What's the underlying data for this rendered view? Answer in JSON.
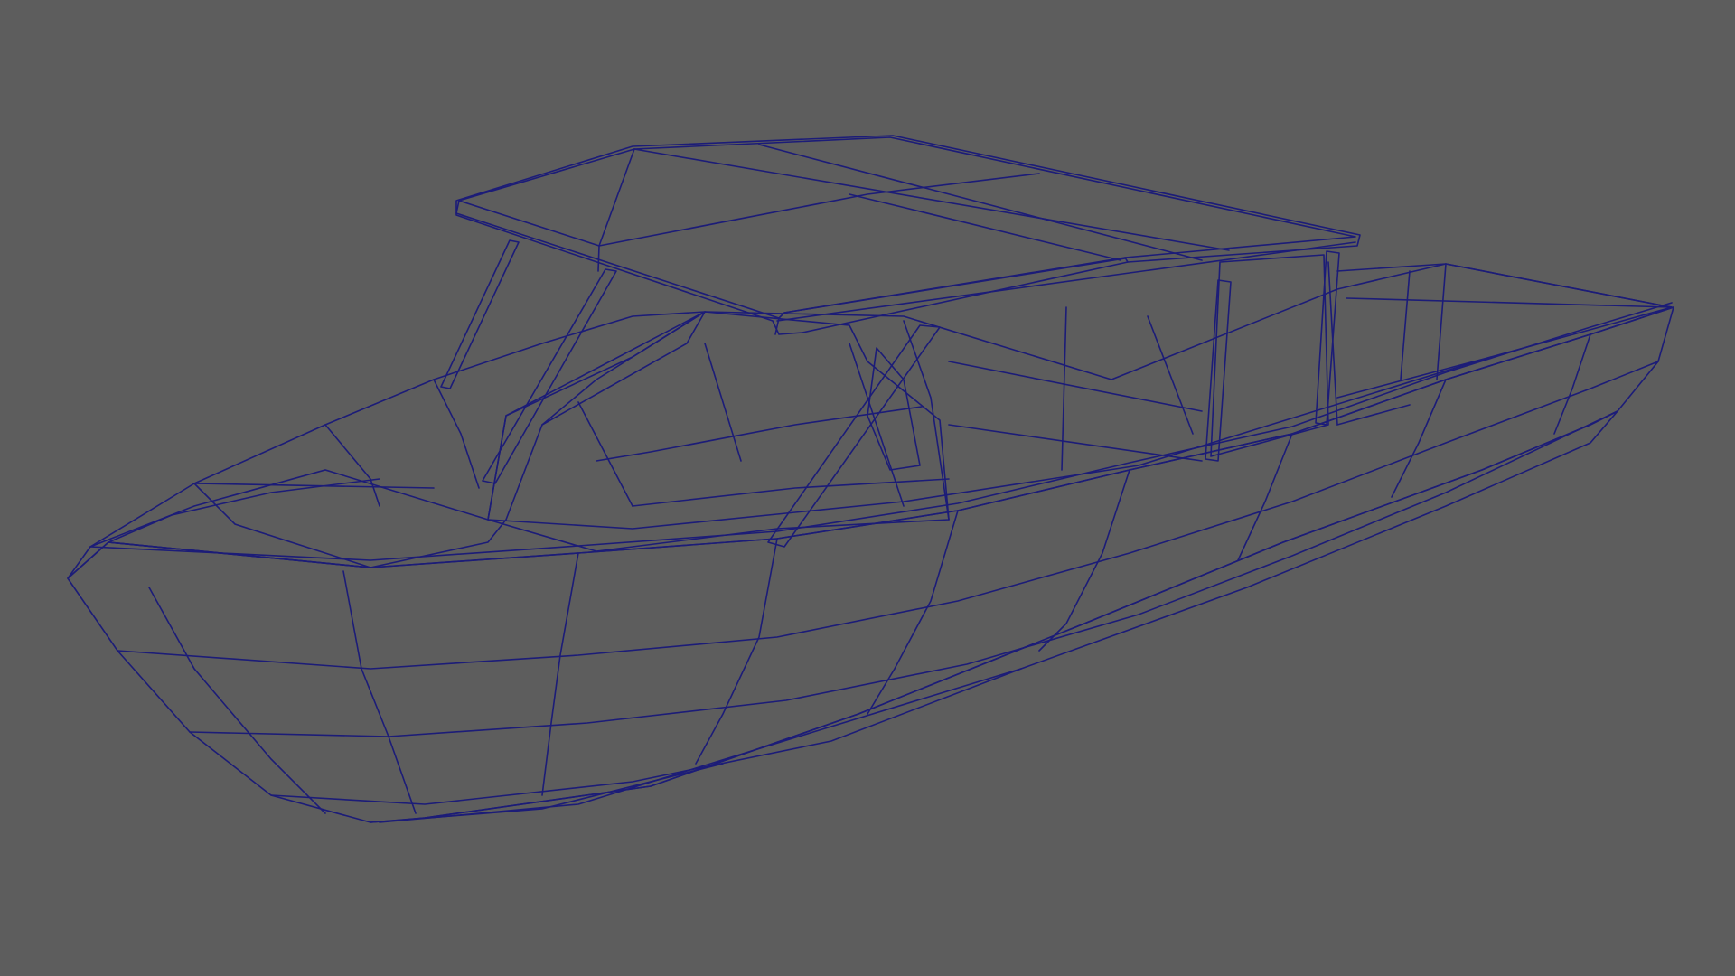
{
  "viewport": {
    "background_color": "#5d5d5d",
    "shading": "smooth-shade-with-wireframe",
    "wireframe_color": "#1c1c78"
  },
  "scene": {
    "object": "boat",
    "colors": {
      "hull": "#8a8a8a",
      "hull_light": "#949494",
      "interior": "#979797",
      "interior_dark": "#848484",
      "roof": "#8f8f8f",
      "roof_edge": "#9c9c9c",
      "keel": "#3a3a3a",
      "windshield": "#a3a3a3",
      "strut": "#a0a0a0"
    }
  }
}
